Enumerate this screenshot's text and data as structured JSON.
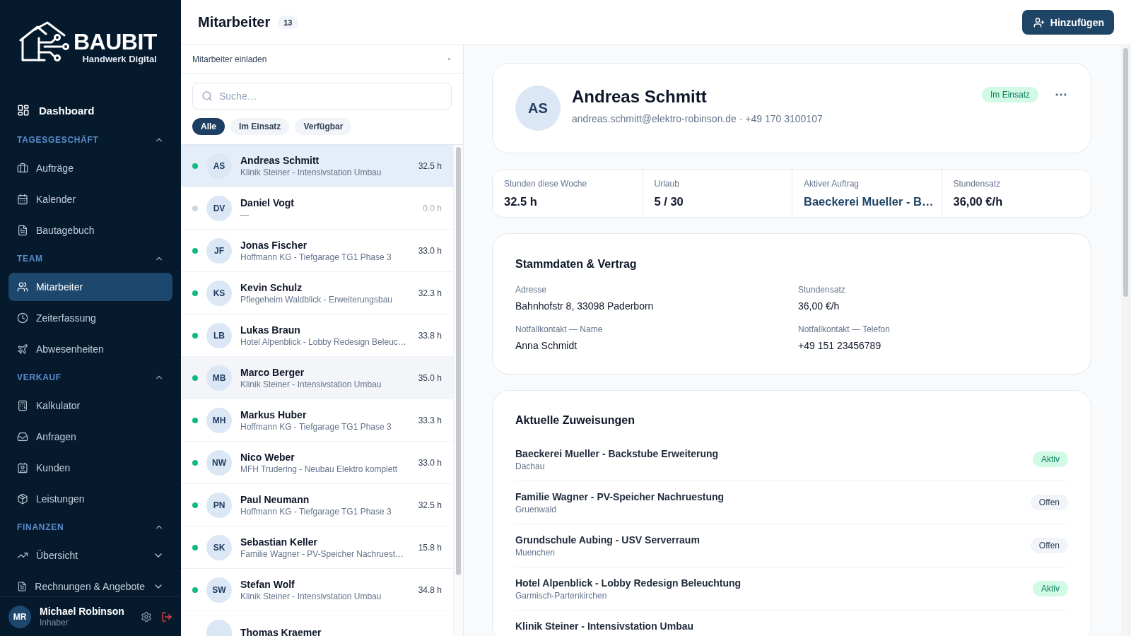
{
  "sidebar": {
    "brand": {
      "name": "BAUBIT",
      "tagline": "Handwerk Digital"
    },
    "dashboard": {
      "label": "Dashboard",
      "selected": false
    },
    "sections": [
      {
        "title": "TAGESGESCHÄFT",
        "expanded": true,
        "items": [
          {
            "label": "Aufträge",
            "selected": false
          },
          {
            "label": "Kalender",
            "selected": false
          },
          {
            "label": "Bautagebuch",
            "selected": false
          }
        ]
      },
      {
        "title": "TEAM",
        "expanded": true,
        "items": [
          {
            "label": "Mitarbeiter",
            "selected": true
          },
          {
            "label": "Zeiterfassung",
            "selected": false
          },
          {
            "label": "Abwesenheiten",
            "selected": false
          }
        ]
      },
      {
        "title": "VERKAUF",
        "expanded": true,
        "items": [
          {
            "label": "Kalkulator",
            "selected": false
          },
          {
            "label": "Anfragen",
            "selected": false
          },
          {
            "label": "Kunden",
            "selected": false
          },
          {
            "label": "Leistungen",
            "selected": false
          }
        ]
      },
      {
        "title": "FINANZEN",
        "expanded": true,
        "items": [
          {
            "label": "Übersicht",
            "selected": false,
            "expanded": false
          },
          {
            "label": "Rechnungen & Angebote",
            "selected": false,
            "expanded": false
          }
        ]
      }
    ],
    "user": {
      "initials": "MR",
      "name": "Michael Robinson",
      "role": "Inhaber"
    }
  },
  "header": {
    "title": "Mitarbeiter",
    "count": "13",
    "add_button": "Hinzufügen"
  },
  "employees": {
    "invite": "Mitarbeiter einladen",
    "search": {
      "placeholder": "Suche…"
    },
    "filters": [
      {
        "label": "Alle",
        "selected": true
      },
      {
        "label": "Im Einsatz",
        "selected": false
      },
      {
        "label": "Verfügbar",
        "selected": false
      }
    ],
    "list": [
      {
        "initials": "AS",
        "name": "Andreas Schmitt",
        "assignment": "Klinik Steiner - Intensivstation Umbau",
        "hours": "32.5 h",
        "active": true,
        "selected": true,
        "hovered": false
      },
      {
        "initials": "DV",
        "name": "Daniel Vogt",
        "assignment": "—",
        "hours": "0.0 h",
        "active": false,
        "selected": false,
        "hovered": false
      },
      {
        "initials": "JF",
        "name": "Jonas Fischer",
        "assignment": "Hoffmann KG - Tiefgarage TG1 Phase 3",
        "hours": "33.0 h",
        "active": true,
        "selected": false,
        "hovered": false
      },
      {
        "initials": "KS",
        "name": "Kevin Schulz",
        "assignment": "Pflegeheim Waldblick - Erweiterungsbau",
        "hours": "32.3 h",
        "active": true,
        "selected": false,
        "hovered": false
      },
      {
        "initials": "LB",
        "name": "Lukas Braun",
        "assignment": "Hotel Alpenblick - Lobby Redesign Beleuc…",
        "hours": "33.8 h",
        "active": true,
        "selected": false,
        "hovered": false
      },
      {
        "initials": "MB",
        "name": "Marco Berger",
        "assignment": "Klinik Steiner - Intensivstation Umbau",
        "hours": "35.0 h",
        "active": true,
        "selected": false,
        "hovered": true
      },
      {
        "initials": "MH",
        "name": "Markus Huber",
        "assignment": "Hoffmann KG - Tiefgarage TG1 Phase 3",
        "hours": "33.3 h",
        "active": true,
        "selected": false,
        "hovered": false
      },
      {
        "initials": "NW",
        "name": "Nico Weber",
        "assignment": "MFH Trudering - Neubau Elektro komplett",
        "hours": "33.0 h",
        "active": true,
        "selected": false,
        "hovered": false
      },
      {
        "initials": "PN",
        "name": "Paul Neumann",
        "assignment": "Hoffmann KG - Tiefgarage TG1 Phase 3",
        "hours": "32.5 h",
        "active": true,
        "selected": false,
        "hovered": false
      },
      {
        "initials": "SK",
        "name": "Sebastian Keller",
        "assignment": "Familie Wagner - PV-Speicher Nachruest…",
        "hours": "15.8 h",
        "active": true,
        "selected": false,
        "hovered": false
      },
      {
        "initials": "SW",
        "name": "Stefan Wolf",
        "assignment": "Klinik Steiner - Intensivstation Umbau",
        "hours": "34.8 h",
        "active": true,
        "selected": false,
        "hovered": false
      },
      {
        "name": "Thomas Kraemer",
        "selected": false,
        "hovered": false
      }
    ]
  },
  "detail": {
    "profile": {
      "initials": "AS",
      "name": "Andreas Schmitt",
      "contact": "andreas.schmitt@elektro-robinson.de · +49 170 3100107",
      "status": "Im Einsatz",
      "active": true
    },
    "stats": [
      {
        "label": "Stunden diese Woche",
        "value": "32.5 h",
        "kind": "plain"
      },
      {
        "label": "Urlaub",
        "value": "5 / 30",
        "kind": "plain"
      },
      {
        "label": "Aktiver Auftrag",
        "value": "Baeckerei Mueller - B…",
        "kind": "link"
      },
      {
        "label": "Stundensatz",
        "value": "36,00 €/h",
        "kind": "plain"
      }
    ],
    "master_data": {
      "title": "Stammdaten & Vertrag",
      "fields": [
        {
          "label": "Adresse",
          "value": "Bahnhofstr 8, 33098 Paderborn"
        },
        {
          "label": "Stundensatz",
          "value": "36,00 €/h"
        },
        {
          "label": "Notfallkontakt — Name",
          "value": "Anna Schmidt"
        },
        {
          "label": "Notfallkontakt — Telefon",
          "value": "+49 151 23456789"
        }
      ]
    },
    "assignments": {
      "title": "Aktuelle Zuweisungen",
      "items": [
        {
          "title": "Baeckerei Mueller - Backstube Erweiterung",
          "location": "Dachau",
          "status": "Aktiv",
          "active": true
        },
        {
          "title": "Familie Wagner - PV-Speicher Nachruestung",
          "location": "Gruenwald",
          "status": "Offen",
          "active": false
        },
        {
          "title": "Grundschule Aubing - USV Serverraum",
          "location": "Muenchen",
          "status": "Offen",
          "active": false
        },
        {
          "title": "Hotel Alpenblick - Lobby Redesign Beleuchtung",
          "location": "Garmisch-Partenkirchen",
          "status": "Aktiv",
          "active": true
        },
        {
          "title": "Klinik Steiner - Intensivstation Umbau"
        }
      ]
    }
  }
}
